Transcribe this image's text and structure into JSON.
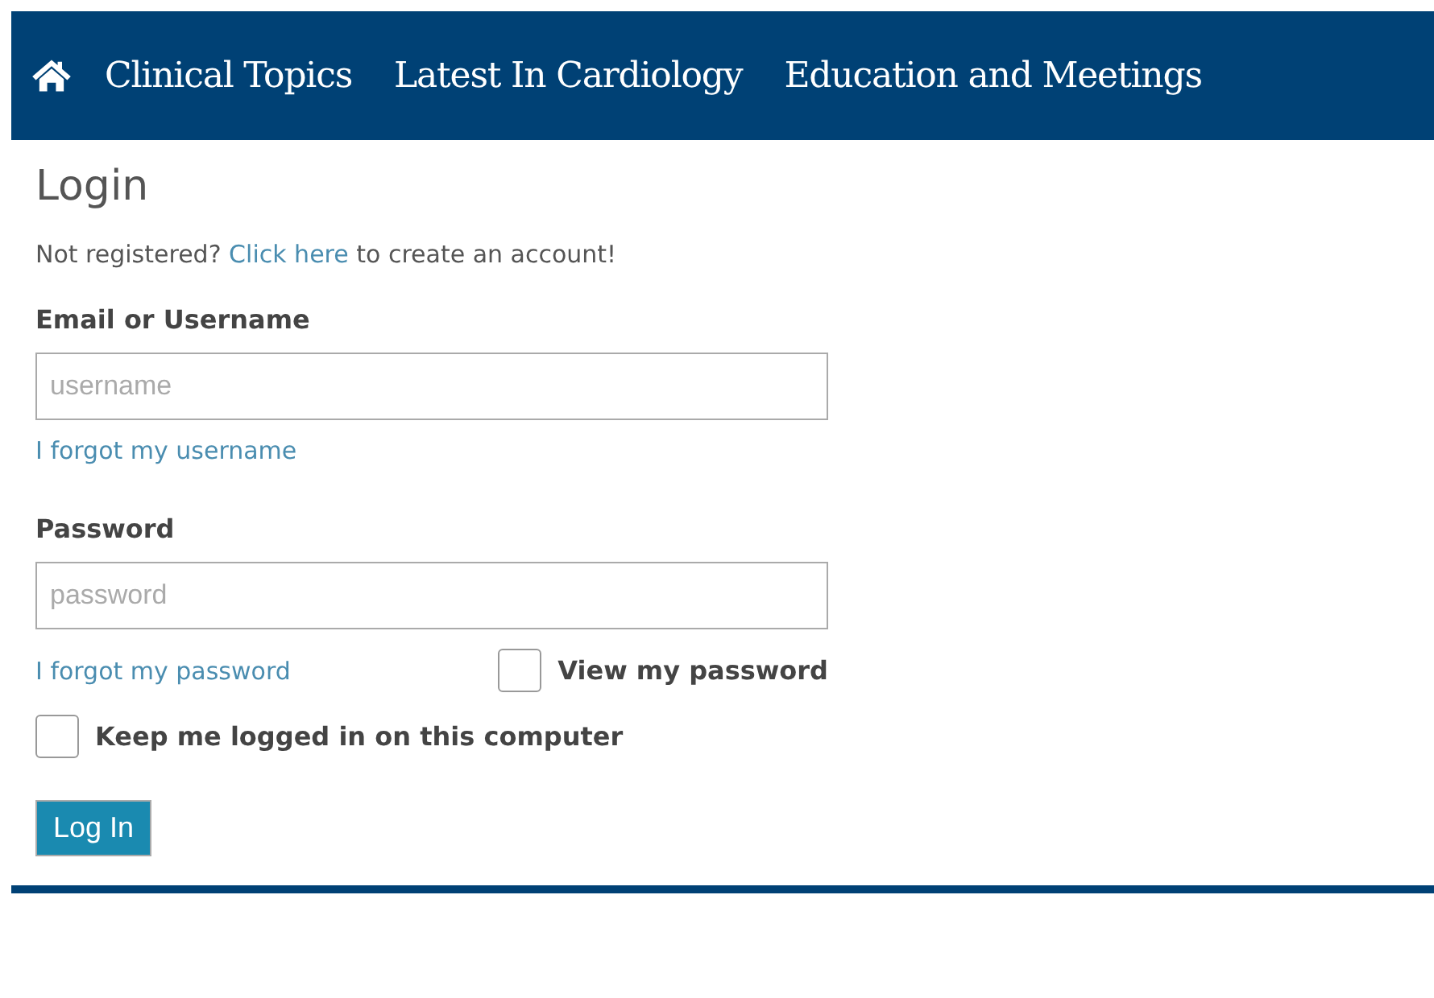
{
  "nav": {
    "items": [
      {
        "label": "Clinical Topics"
      },
      {
        "label": "Latest In Cardiology"
      },
      {
        "label": "Education and Meetings"
      }
    ]
  },
  "login": {
    "title": "Login",
    "register": {
      "before": "Not registered? ",
      "link": "Click here",
      "after": " to create an account!"
    },
    "username": {
      "label": "Email or Username",
      "placeholder": "username",
      "forgot": "I forgot my username"
    },
    "password": {
      "label": "Password",
      "placeholder": "password",
      "forgot": "I forgot my password"
    },
    "view_password": {
      "label": "View my password",
      "checked": false
    },
    "keep_logged_in": {
      "label": "Keep me logged in on this computer",
      "checked": false
    },
    "submit": "Log In"
  }
}
